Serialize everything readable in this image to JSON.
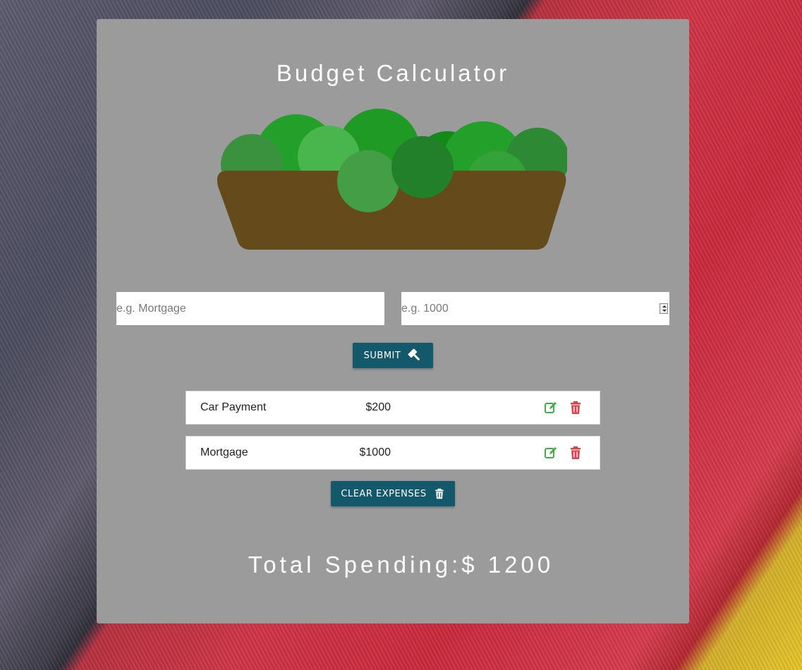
{
  "app": {
    "title": "Budget Calculator"
  },
  "form": {
    "name_placeholder": "e.g. Mortgage",
    "amount_placeholder": "e.g. 1000",
    "submit_label": "SUBMIT",
    "submit_icon": "gavel-icon"
  },
  "expenses": [
    {
      "name": "Car Payment",
      "amount": "$200",
      "edit_icon": "edit-icon",
      "delete_icon": "trash-icon"
    },
    {
      "name": "Mortgage",
      "amount": "$1000",
      "edit_icon": "edit-icon",
      "delete_icon": "trash-icon"
    }
  ],
  "clear_button": {
    "label": "CLEAR EXPENSES",
    "icon": "trash-icon"
  },
  "total": {
    "text": "Total Spending:$ 1200"
  },
  "colors": {
    "panel": "#9b9b9b",
    "button": "#14596b",
    "edit_icon": "#3fae49",
    "delete_icon": "#d9434f",
    "basket": "#654a1b"
  }
}
